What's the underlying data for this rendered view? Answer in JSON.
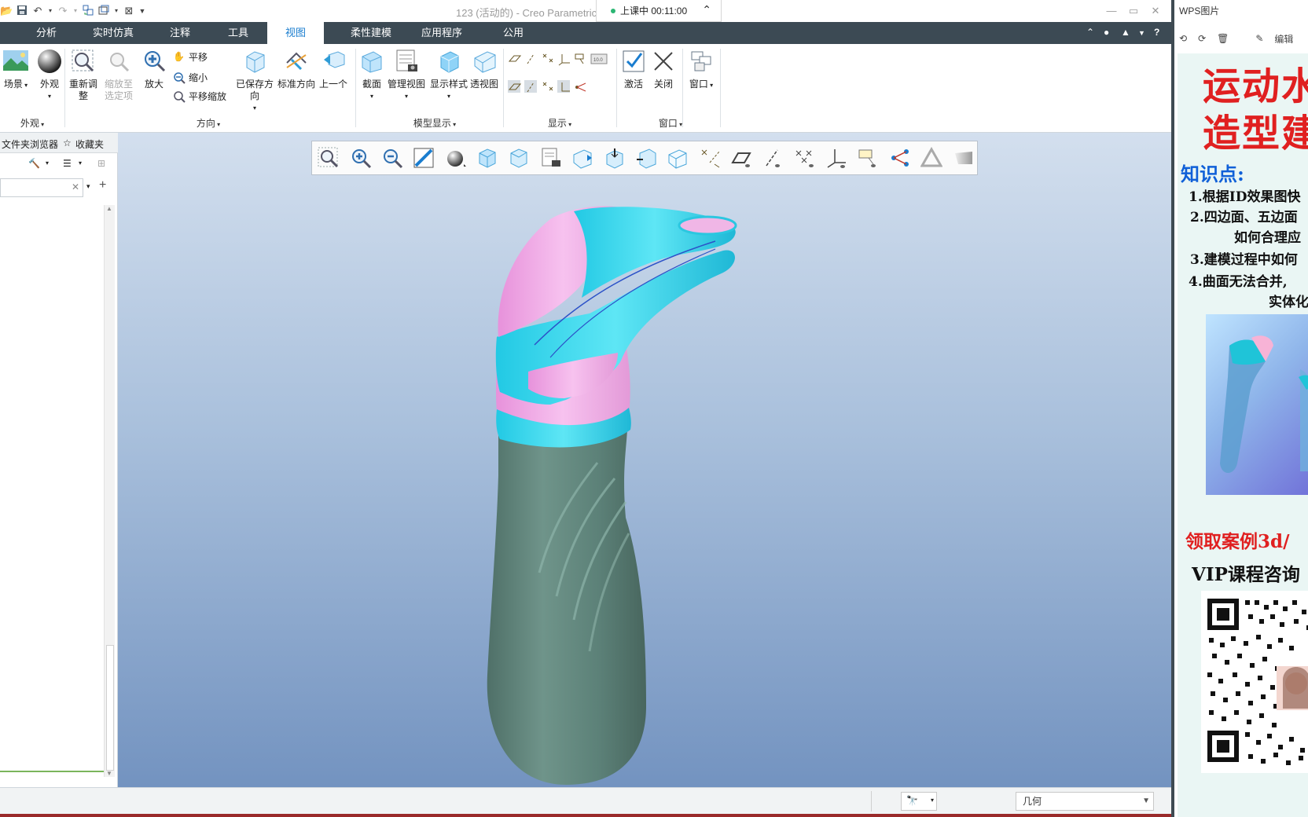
{
  "window": {
    "title": "123 (活动的) - Creo Parametric",
    "recording_label": "上课中 00:11:00"
  },
  "ribbon_tabs": [
    {
      "label": "分析"
    },
    {
      "label": "实时仿真"
    },
    {
      "label": "注释"
    },
    {
      "label": "工具"
    },
    {
      "label": "视图"
    },
    {
      "label": "柔性建模"
    },
    {
      "label": "应用程序"
    },
    {
      "label": "公用"
    }
  ],
  "active_tab": "视图",
  "ribbon": {
    "appearance": {
      "scene": "场景",
      "appearance": "外观",
      "group": "外观"
    },
    "orientation": {
      "refit": "重新调整",
      "zoom_to_selected": "缩放至选定项",
      "zoom_in": "放大",
      "pan": "平移",
      "zoom_out": "缩小",
      "pan_zoom": "平移缩放",
      "saved_orientations": "已保存方向",
      "standard_orientation": "标准方向",
      "previous": "上一个",
      "group": "方向"
    },
    "model_display": {
      "section": "截面",
      "manage_views": "管理视图",
      "display_style": "显示样式",
      "perspective": "透视图",
      "group": "模型显示"
    },
    "show": {
      "group": "显示"
    },
    "window": {
      "activate": "激活",
      "close": "关闭",
      "windows": "窗口",
      "group": "窗口"
    }
  },
  "left_panel": {
    "tab_folder": "文件夹浏览器",
    "tab_favorites": "收藏夹"
  },
  "status_bar": {
    "filter_value": "几何"
  },
  "wps": {
    "title": "WPS图片",
    "edit_label": "编辑",
    "heading_line1": "运动水",
    "heading_line2": "造型建",
    "knowledge_title": "知识点:",
    "points": [
      "1.根据ID效果图快",
      "2.四边面、五边面",
      "如何合理应",
      "3.建模过程中如何",
      "4.曲面无法合并,",
      "实体化处"
    ],
    "cta_red": "领取案例3d/",
    "cta_vip": "VIP课程咨询"
  },
  "colors": {
    "tab_bar": "#3c4a54",
    "accent": "#1a7dcf",
    "bottle_body": "#5f847b",
    "bottle_cyan": "#36dbef",
    "bottle_pink": "#f1a9e6",
    "wps_red": "#e02020"
  }
}
